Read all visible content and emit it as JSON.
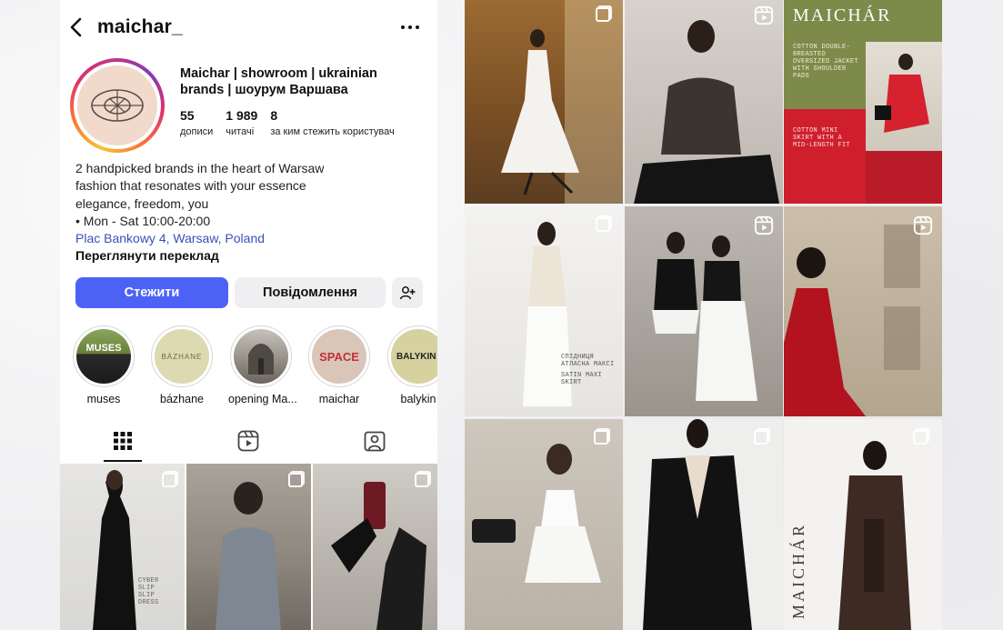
{
  "header": {
    "username": "maichar_"
  },
  "profile": {
    "name": "Maichar | showroom | ukrainian brands | шоурум Варшава",
    "stats": [
      {
        "value": "55",
        "label": "дописи"
      },
      {
        "value": "1 989",
        "label": "читачі"
      },
      {
        "value": "8",
        "label": "за ким стежить користувач"
      }
    ],
    "bio_lines": [
      "2 handpicked brands in the heart of Warsaw",
      "fashion that resonates with your essence",
      "elegance, freedom, you",
      "• Mon - Sat 10:00-20:00"
    ],
    "location_link": "Plac Bankowy 4, Warsaw, Poland",
    "translate_label": "Переглянути переклад"
  },
  "actions": {
    "follow_label": "Стежити",
    "message_label": "Повідомлення"
  },
  "highlights": [
    {
      "label": "muses",
      "cover_text": "MUSES"
    },
    {
      "label": "bázhane",
      "cover_text": "BÁZHANE"
    },
    {
      "label": "opening Ma...",
      "cover_text": ""
    },
    {
      "label": "maichar",
      "cover_text": "SPACE"
    },
    {
      "label": "balykin",
      "cover_text": "BALYKIN"
    }
  ],
  "tabs": [
    {
      "name": "grid-icon",
      "active": true
    },
    {
      "name": "reels-icon",
      "active": false
    },
    {
      "name": "tagged-icon",
      "active": false
    }
  ],
  "left_grid_text": {
    "tile1": [
      "CYBER",
      "SLIP",
      "SLIP",
      "DRESS"
    ]
  },
  "right_grid_text": {
    "brand": "MAICHÁR",
    "jacket_caption": "COTTON DOUBLE-BREASTED OVERSIZED JACKET WITH SHOULDER PADS",
    "skirt_caption": "COTTON MINI SKIRT WITH A MID-LENGTH FIT",
    "satin_caption_ua": "СПІДНИЦЯ АТЛАСНА МАКСІ",
    "satin_caption_en": "SATIN MAXI SKIRT",
    "vertical_brand": "MAICHÁR"
  },
  "colors": {
    "follow_blue": "#4c62f5",
    "link_blue": "#3a4fb8",
    "avatar_bg": "#f1dacb",
    "brand_olive": "#7d8a4a"
  }
}
